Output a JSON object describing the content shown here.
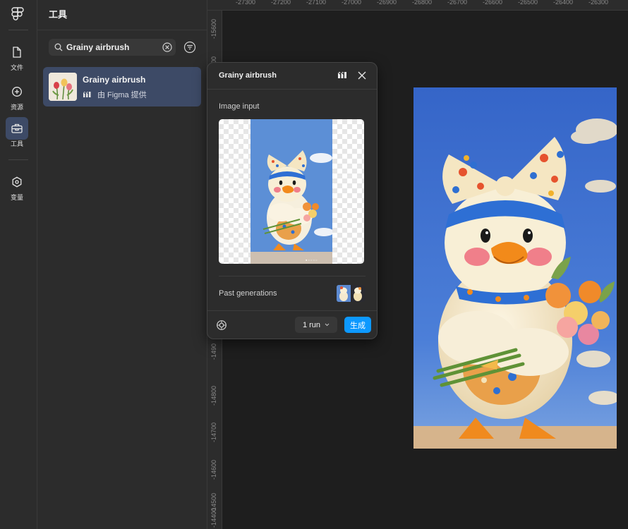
{
  "rail": {
    "items": [
      {
        "label": "文件",
        "icon": "file-icon"
      },
      {
        "label": "资源",
        "icon": "assets-icon"
      },
      {
        "label": "工具",
        "icon": "toolbox-icon"
      },
      {
        "label": "变量",
        "icon": "variables-icon"
      }
    ],
    "active": "工具"
  },
  "panel": {
    "title": "工具",
    "search": {
      "value": "Grainy airbrush",
      "placeholder": ""
    },
    "result": {
      "name": "Grainy airbrush",
      "by": "由 Figma 提供"
    }
  },
  "ruler": {
    "top": [
      "-27300",
      "-27200",
      "-27100",
      "-27000",
      "-26900",
      "-26800",
      "-26700",
      "-26600",
      "-26500",
      "-26400",
      "-26300"
    ],
    "left": [
      "-15600",
      "700",
      "-1490",
      "-14800",
      "-14700",
      "-14600",
      "-14500",
      "-14400"
    ]
  },
  "popup": {
    "title": "Grainy airbrush",
    "image_input_label": "Image input",
    "past_generations_label": "Past generations",
    "run_label": "1 run",
    "generate_label": "生成"
  },
  "colors": {
    "accent": "#0d99ff",
    "selection": "#3d4a66",
    "panel_bg": "#2c2c2c",
    "canvas_bg": "#1e1e1e"
  }
}
